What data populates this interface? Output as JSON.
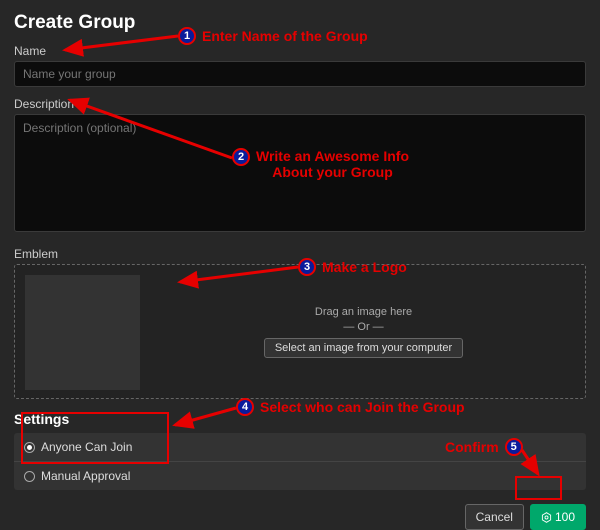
{
  "title": "Create Group",
  "name": {
    "label": "Name",
    "placeholder": "Name your group"
  },
  "description": {
    "label": "Description",
    "placeholder": "Description (optional)"
  },
  "emblem": {
    "label": "Emblem",
    "drag_text": "Drag an image here",
    "or_text": "— Or —",
    "select_button": "Select an image from your computer"
  },
  "settings": {
    "title": "Settings",
    "options": [
      {
        "label": "Anyone Can Join",
        "selected": true
      },
      {
        "label": "Manual Approval",
        "selected": false
      }
    ]
  },
  "buttons": {
    "cancel": "Cancel",
    "confirm_cost": "100"
  },
  "annotations": {
    "a1": "Enter Name of the Group",
    "a2_l1": "Write an Awesome Info",
    "a2_l2": "About your Group",
    "a3": "Make a Logo",
    "a4": "Select who can Join the Group",
    "a5": "Confirm"
  }
}
